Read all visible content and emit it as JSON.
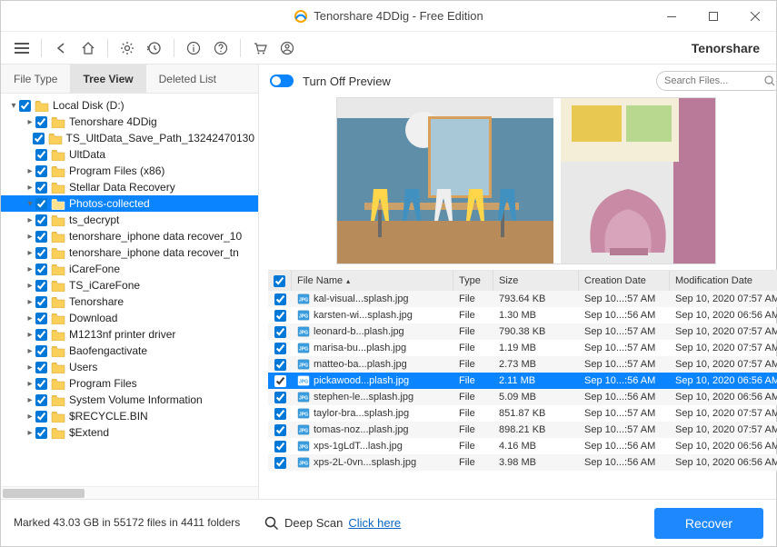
{
  "window": {
    "title": "Tenorshare 4DDig - Free Edition"
  },
  "brand": "Tenorshare",
  "tabs": {
    "file_type": "File Type",
    "tree_view": "Tree View",
    "deleted_list": "Deleted List"
  },
  "preview_toggle": "Turn Off Preview",
  "search_placeholder": "Search Files...",
  "tree": [
    {
      "level": 0,
      "caret": "down",
      "label": "Local Disk (D:)"
    },
    {
      "level": 1,
      "caret": "right",
      "label": "Tenorshare 4DDig"
    },
    {
      "level": 1,
      "caret": "none",
      "label": "TS_UltData_Save_Path_13242470130"
    },
    {
      "level": 1,
      "caret": "none",
      "label": "UltData"
    },
    {
      "level": 1,
      "caret": "right",
      "label": "Program Files (x86)"
    },
    {
      "level": 1,
      "caret": "right",
      "label": "Stellar Data Recovery"
    },
    {
      "level": 1,
      "caret": "down",
      "label": "Photos-collected",
      "selected": true
    },
    {
      "level": 1,
      "caret": "right",
      "label": "ts_decrypt"
    },
    {
      "level": 1,
      "caret": "right",
      "label": "tenorshare_iphone data recover_10"
    },
    {
      "level": 1,
      "caret": "right",
      "label": "tenorshare_iphone data recover_tn"
    },
    {
      "level": 1,
      "caret": "right",
      "label": "iCareFone"
    },
    {
      "level": 1,
      "caret": "right",
      "label": "TS_iCareFone"
    },
    {
      "level": 1,
      "caret": "right",
      "label": "Tenorshare"
    },
    {
      "level": 1,
      "caret": "right",
      "label": "Download"
    },
    {
      "level": 1,
      "caret": "right",
      "label": "M1213nf printer driver"
    },
    {
      "level": 1,
      "caret": "right",
      "label": "Baofengactivate"
    },
    {
      "level": 1,
      "caret": "right",
      "label": "Users"
    },
    {
      "level": 1,
      "caret": "right",
      "label": "Program Files"
    },
    {
      "level": 1,
      "caret": "right",
      "label": "System Volume Information"
    },
    {
      "level": 1,
      "caret": "right",
      "label": "$RECYCLE.BIN"
    },
    {
      "level": 1,
      "caret": "right",
      "label": "$Extend"
    }
  ],
  "grid": {
    "headers": {
      "name": "File Name",
      "type": "Type",
      "size": "Size",
      "cdate": "Creation Date",
      "mdate": "Modification Date"
    },
    "rows": [
      {
        "name": "kal-visual...splash.jpg",
        "type": "File",
        "size": "793.64 KB",
        "cdate": "Sep 10...:57 AM",
        "mdate": "Sep 10, 2020 07:57 AM"
      },
      {
        "name": "karsten-wi...splash.jpg",
        "type": "File",
        "size": "1.30 MB",
        "cdate": "Sep 10...:56 AM",
        "mdate": "Sep 10, 2020 06:56 AM"
      },
      {
        "name": "leonard-b...plash.jpg",
        "type": "File",
        "size": "790.38 KB",
        "cdate": "Sep 10...:57 AM",
        "mdate": "Sep 10, 2020 07:57 AM"
      },
      {
        "name": "marisa-bu...plash.jpg",
        "type": "File",
        "size": "1.19 MB",
        "cdate": "Sep 10...:57 AM",
        "mdate": "Sep 10, 2020 07:57 AM"
      },
      {
        "name": "matteo-ba...plash.jpg",
        "type": "File",
        "size": "2.73 MB",
        "cdate": "Sep 10...:57 AM",
        "mdate": "Sep 10, 2020 07:57 AM"
      },
      {
        "name": "pickawood...plash.jpg",
        "type": "File",
        "size": "2.11 MB",
        "cdate": "Sep 10...:56 AM",
        "mdate": "Sep 10, 2020 06:56 AM",
        "selected": true
      },
      {
        "name": "stephen-le...splash.jpg",
        "type": "File",
        "size": "5.09 MB",
        "cdate": "Sep 10...:56 AM",
        "mdate": "Sep 10, 2020 06:56 AM"
      },
      {
        "name": "taylor-bra...splash.jpg",
        "type": "File",
        "size": "851.87 KB",
        "cdate": "Sep 10...:57 AM",
        "mdate": "Sep 10, 2020 07:57 AM"
      },
      {
        "name": "tomas-noz...plash.jpg",
        "type": "File",
        "size": "898.21 KB",
        "cdate": "Sep 10...:57 AM",
        "mdate": "Sep 10, 2020 07:57 AM"
      },
      {
        "name": "xps-1gLdT...lash.jpg",
        "type": "File",
        "size": "4.16 MB",
        "cdate": "Sep 10...:56 AM",
        "mdate": "Sep 10, 2020 06:56 AM"
      },
      {
        "name": "xps-2L-0vn...splash.jpg",
        "type": "File",
        "size": "3.98 MB",
        "cdate": "Sep 10...:56 AM",
        "mdate": "Sep 10, 2020 06:56 AM"
      }
    ]
  },
  "footer": {
    "status": "Marked 43.03 GB in 55172 files in 4411 folders",
    "deepscan_label": "Deep Scan",
    "deepscan_link": "Click here",
    "recover": "Recover"
  }
}
